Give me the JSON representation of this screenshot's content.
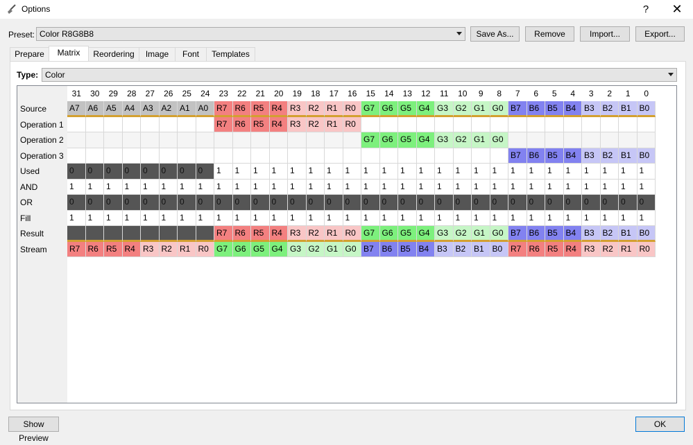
{
  "window": {
    "title": "Options",
    "help_label": "?",
    "close_label": "✕",
    "icon": "broom-icon"
  },
  "preset": {
    "label": "Preset:",
    "value": "Color R8G8B8"
  },
  "buttons": {
    "save_as": "Save As...",
    "remove": "Remove",
    "import": "Import...",
    "export": "Export...",
    "show_preview": "Show Preview",
    "ok": "OK"
  },
  "tabs": [
    "Prepare",
    "Matrix",
    "Reordering",
    "Image",
    "Font",
    "Templates"
  ],
  "active_tab": "Matrix",
  "type": {
    "label": "Type:",
    "value": "Color"
  },
  "matrix": {
    "columns": [
      "31",
      "30",
      "29",
      "28",
      "27",
      "26",
      "25",
      "24",
      "23",
      "22",
      "21",
      "20",
      "19",
      "18",
      "17",
      "16",
      "15",
      "14",
      "13",
      "12",
      "11",
      "10",
      "9",
      "8",
      "7",
      "6",
      "5",
      "4",
      "3",
      "2",
      "1",
      "0"
    ],
    "rows": [
      {
        "label": "Source",
        "cells": [
          "A7",
          "A6",
          "A5",
          "A4",
          "A3",
          "A2",
          "A1",
          "A0",
          "R7",
          "R6",
          "R5",
          "R4",
          "R3",
          "R2",
          "R1",
          "R0",
          "G7",
          "G6",
          "G5",
          "G4",
          "G3",
          "G2",
          "G1",
          "G0",
          "B7",
          "B6",
          "B5",
          "B4",
          "B3",
          "B2",
          "B1",
          "B0"
        ]
      },
      {
        "label": "Operation 1",
        "cells": [
          "",
          "",
          "",
          "",
          "",
          "",
          "",
          "",
          "R7",
          "R6",
          "R5",
          "R4",
          "R3",
          "R2",
          "R1",
          "R0",
          "",
          "",
          "",
          "",
          "",
          "",
          "",
          "",
          "",
          "",
          "",
          "",
          "",
          "",
          "",
          ""
        ]
      },
      {
        "label": "Operation 2",
        "cells": [
          "",
          "",
          "",
          "",
          "",
          "",
          "",
          "",
          "",
          "",
          "",
          "",
          "",
          "",
          "",
          "",
          "G7",
          "G6",
          "G5",
          "G4",
          "G3",
          "G2",
          "G1",
          "G0",
          "",
          "",
          "",
          "",
          "",
          "",
          "",
          ""
        ]
      },
      {
        "label": "Operation 3",
        "cells": [
          "",
          "",
          "",
          "",
          "",
          "",
          "",
          "",
          "",
          "",
          "",
          "",
          "",
          "",
          "",
          "",
          "",
          "",
          "",
          "",
          "",
          "",
          "",
          "",
          "B7",
          "B6",
          "B5",
          "B4",
          "B3",
          "B2",
          "B1",
          "B0"
        ]
      },
      {
        "label": "Used",
        "cells": [
          "0",
          "0",
          "0",
          "0",
          "0",
          "0",
          "0",
          "0",
          "1",
          "1",
          "1",
          "1",
          "1",
          "1",
          "1",
          "1",
          "1",
          "1",
          "1",
          "1",
          "1",
          "1",
          "1",
          "1",
          "1",
          "1",
          "1",
          "1",
          "1",
          "1",
          "1",
          "1"
        ]
      },
      {
        "label": "AND",
        "cells": [
          "1",
          "1",
          "1",
          "1",
          "1",
          "1",
          "1",
          "1",
          "1",
          "1",
          "1",
          "1",
          "1",
          "1",
          "1",
          "1",
          "1",
          "1",
          "1",
          "1",
          "1",
          "1",
          "1",
          "1",
          "1",
          "1",
          "1",
          "1",
          "1",
          "1",
          "1",
          "1"
        ]
      },
      {
        "label": "OR",
        "cells": [
          "0",
          "0",
          "0",
          "0",
          "0",
          "0",
          "0",
          "0",
          "0",
          "0",
          "0",
          "0",
          "0",
          "0",
          "0",
          "0",
          "0",
          "0",
          "0",
          "0",
          "0",
          "0",
          "0",
          "0",
          "0",
          "0",
          "0",
          "0",
          "0",
          "0",
          "0",
          "0"
        ]
      },
      {
        "label": "Fill",
        "cells": [
          "1",
          "1",
          "1",
          "1",
          "1",
          "1",
          "1",
          "1",
          "1",
          "1",
          "1",
          "1",
          "1",
          "1",
          "1",
          "1",
          "1",
          "1",
          "1",
          "1",
          "1",
          "1",
          "1",
          "1",
          "1",
          "1",
          "1",
          "1",
          "1",
          "1",
          "1",
          "1"
        ]
      },
      {
        "label": "Result",
        "cells": [
          "",
          "",
          "",
          "",
          "",
          "",
          "",
          "",
          "R7",
          "R6",
          "R5",
          "R4",
          "R3",
          "R2",
          "R1",
          "R0",
          "G7",
          "G6",
          "G5",
          "G4",
          "G3",
          "G2",
          "G1",
          "G0",
          "B7",
          "B6",
          "B5",
          "B4",
          "B3",
          "B2",
          "B1",
          "B0"
        ]
      },
      {
        "label": "Stream",
        "cells": [
          "R7",
          "R6",
          "R5",
          "R4",
          "R3",
          "R2",
          "R1",
          "R0",
          "G7",
          "G6",
          "G5",
          "G4",
          "G3",
          "G2",
          "G1",
          "G0",
          "B7",
          "B6",
          "B5",
          "B4",
          "B3",
          "B2",
          "B1",
          "B0",
          "R7",
          "R6",
          "R5",
          "R4",
          "R3",
          "R2",
          "R1",
          "R0"
        ]
      }
    ]
  },
  "colors": {
    "alpha": "#c2c2c2",
    "red_dark": "#f38080",
    "red_light": "#f9c6c6",
    "green_dark": "#7df07d",
    "green_light": "#c6f6c6",
    "blue_dark": "#8282f0",
    "blue_light": "#c6c6f6",
    "dark_cell": "#555555",
    "light_cell": "#f5f5f5",
    "white_cell": "#ffffff",
    "underline": "#d3a030"
  }
}
